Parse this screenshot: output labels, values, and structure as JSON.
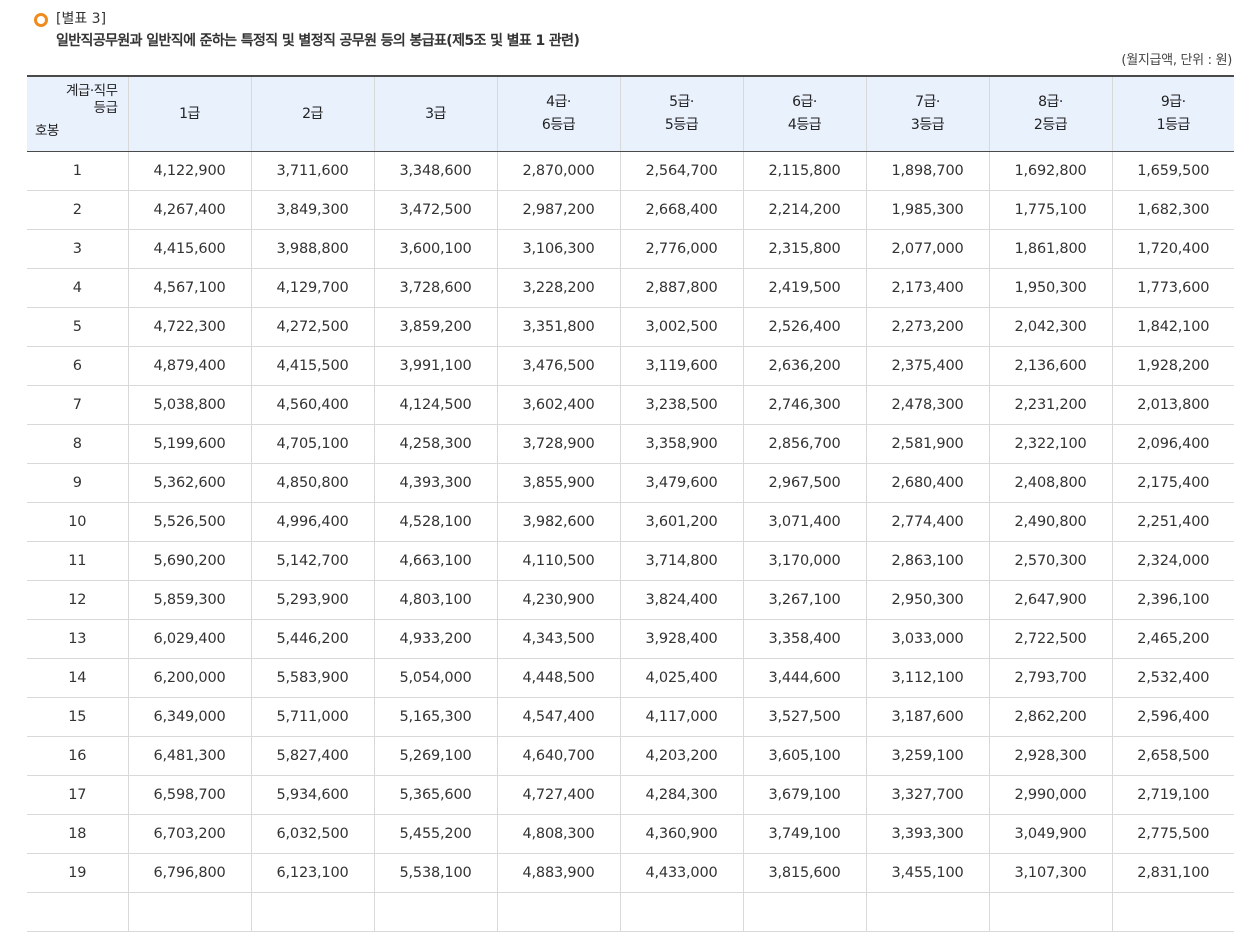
{
  "header": {
    "bracket_title": "[별표 3]",
    "subtitle": "일반직공무원과 일반직에 준하는 특정직 및 별정직 공무원 등의 봉급표(제5조 및 별표 1 관련)",
    "unit_note": "(월지급액, 단위 : 원)",
    "icon": "circle-bullet-icon",
    "accent_color": "#f08c1e"
  },
  "table": {
    "corner": {
      "top_line1": "계급·직무",
      "top_line2": "등급",
      "bottom": "호봉"
    },
    "columns": [
      [
        "1급"
      ],
      [
        "2급"
      ],
      [
        "3급"
      ],
      [
        "4급·",
        "6등급"
      ],
      [
        "5급·",
        "5등급"
      ],
      [
        "6급·",
        "4등급"
      ],
      [
        "7급·",
        "3등급"
      ],
      [
        "8급·",
        "2등급"
      ],
      [
        "9급·",
        "1등급"
      ]
    ],
    "rows": [
      [
        "1",
        "4,122,900",
        "3,711,600",
        "3,348,600",
        "2,870,000",
        "2,564,700",
        "2,115,800",
        "1,898,700",
        "1,692,800",
        "1,659,500"
      ],
      [
        "2",
        "4,267,400",
        "3,849,300",
        "3,472,500",
        "2,987,200",
        "2,668,400",
        "2,214,200",
        "1,985,300",
        "1,775,100",
        "1,682,300"
      ],
      [
        "3",
        "4,415,600",
        "3,988,800",
        "3,600,100",
        "3,106,300",
        "2,776,000",
        "2,315,800",
        "2,077,000",
        "1,861,800",
        "1,720,400"
      ],
      [
        "4",
        "4,567,100",
        "4,129,700",
        "3,728,600",
        "3,228,200",
        "2,887,800",
        "2,419,500",
        "2,173,400",
        "1,950,300",
        "1,773,600"
      ],
      [
        "5",
        "4,722,300",
        "4,272,500",
        "3,859,200",
        "3,351,800",
        "3,002,500",
        "2,526,400",
        "2,273,200",
        "2,042,300",
        "1,842,100"
      ],
      [
        "6",
        "4,879,400",
        "4,415,500",
        "3,991,100",
        "3,476,500",
        "3,119,600",
        "2,636,200",
        "2,375,400",
        "2,136,600",
        "1,928,200"
      ],
      [
        "7",
        "5,038,800",
        "4,560,400",
        "4,124,500",
        "3,602,400",
        "3,238,500",
        "2,746,300",
        "2,478,300",
        "2,231,200",
        "2,013,800"
      ],
      [
        "8",
        "5,199,600",
        "4,705,100",
        "4,258,300",
        "3,728,900",
        "3,358,900",
        "2,856,700",
        "2,581,900",
        "2,322,100",
        "2,096,400"
      ],
      [
        "9",
        "5,362,600",
        "4,850,800",
        "4,393,300",
        "3,855,900",
        "3,479,600",
        "2,967,500",
        "2,680,400",
        "2,408,800",
        "2,175,400"
      ],
      [
        "10",
        "5,526,500",
        "4,996,400",
        "4,528,100",
        "3,982,600",
        "3,601,200",
        "3,071,400",
        "2,774,400",
        "2,490,800",
        "2,251,400"
      ],
      [
        "11",
        "5,690,200",
        "5,142,700",
        "4,663,100",
        "4,110,500",
        "3,714,800",
        "3,170,000",
        "2,863,100",
        "2,570,300",
        "2,324,000"
      ],
      [
        "12",
        "5,859,300",
        "5,293,900",
        "4,803,100",
        "4,230,900",
        "3,824,400",
        "3,267,100",
        "2,950,300",
        "2,647,900",
        "2,396,100"
      ],
      [
        "13",
        "6,029,400",
        "5,446,200",
        "4,933,200",
        "4,343,500",
        "3,928,400",
        "3,358,400",
        "3,033,000",
        "2,722,500",
        "2,465,200"
      ],
      [
        "14",
        "6,200,000",
        "5,583,900",
        "5,054,000",
        "4,448,500",
        "4,025,400",
        "3,444,600",
        "3,112,100",
        "2,793,700",
        "2,532,400"
      ],
      [
        "15",
        "6,349,000",
        "5,711,000",
        "5,165,300",
        "4,547,400",
        "4,117,000",
        "3,527,500",
        "3,187,600",
        "2,862,200",
        "2,596,400"
      ],
      [
        "16",
        "6,481,300",
        "5,827,400",
        "5,269,100",
        "4,640,700",
        "4,203,200",
        "3,605,100",
        "3,259,100",
        "2,928,300",
        "2,658,500"
      ],
      [
        "17",
        "6,598,700",
        "5,934,600",
        "5,365,600",
        "4,727,400",
        "4,284,300",
        "3,679,100",
        "3,327,700",
        "2,990,000",
        "2,719,100"
      ],
      [
        "18",
        "6,703,200",
        "6,032,500",
        "5,455,200",
        "4,808,300",
        "4,360,900",
        "3,749,100",
        "3,393,300",
        "3,049,900",
        "2,775,500"
      ],
      [
        "19",
        "6,796,800",
        "6,123,100",
        "5,538,100",
        "4,883,900",
        "4,433,000",
        "3,815,600",
        "3,455,100",
        "3,107,300",
        "2,831,100"
      ],
      [
        "",
        "",
        "",
        "",
        "",
        "",
        "",
        "",
        "",
        ""
      ]
    ]
  }
}
